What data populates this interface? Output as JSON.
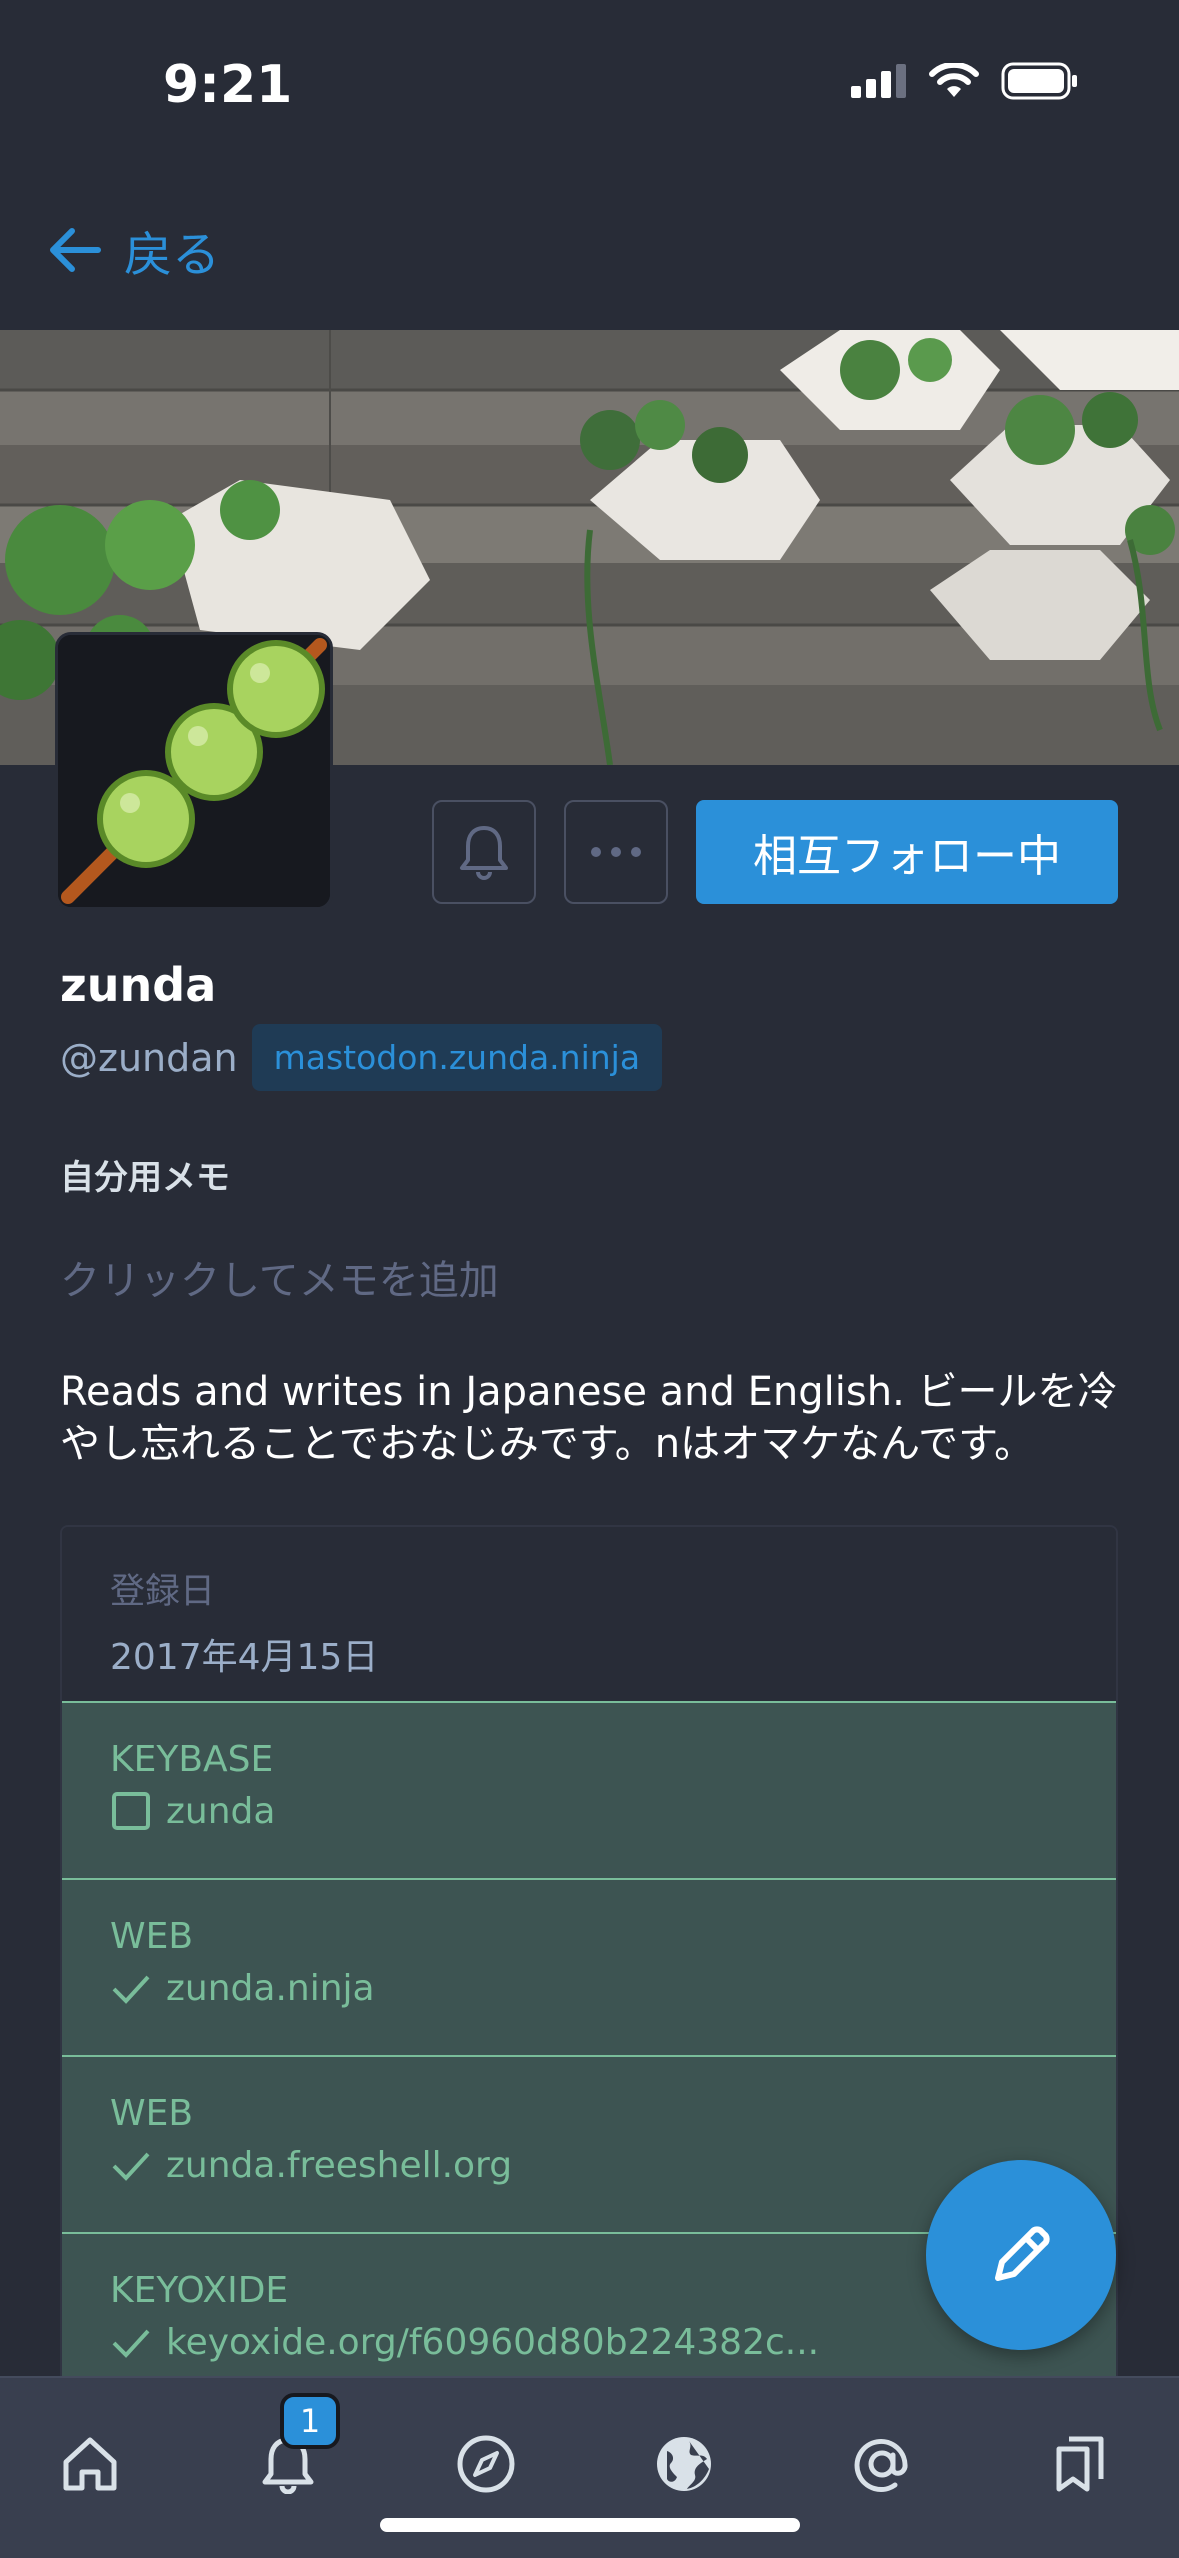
{
  "status_bar": {
    "time": "9:21"
  },
  "nav": {
    "back_label": "戻る"
  },
  "profile": {
    "display_name": "zunda",
    "username": "@zundan",
    "domain": "mastodon.zunda.ninja",
    "follow_label": "相互フォロー中",
    "memo_label": "自分用メモ",
    "memo_placeholder": "クリックしてメモを追加",
    "bio": "Reads and writes in Japanese and English. ビールを冷やし忘れることでおなじみです。nはオマケなんです。"
  },
  "fields": {
    "joined": {
      "label": "登録日",
      "value": "2017年4月15日"
    },
    "items": [
      {
        "label": "KEYBASE",
        "value": "zunda",
        "icon": "checkbox-icon"
      },
      {
        "label": "WEB",
        "value": "zunda.ninja",
        "icon": "check-icon"
      },
      {
        "label": "WEB",
        "value": "zunda.freeshell.org",
        "icon": "check-icon"
      },
      {
        "label": "KEYOXIDE",
        "value": "keyoxide.org/f60960d80b224382c...",
        "icon": "check-icon"
      }
    ]
  },
  "tab_bar": {
    "notification_count": "1",
    "tabs": [
      "home-icon",
      "bell-icon",
      "compass-icon",
      "globe-icon",
      "at-icon",
      "bookmarks-icon"
    ]
  },
  "colors": {
    "background": "#282c37",
    "accent": "#2b90d9",
    "verified": "#79bd9a",
    "verified_bg": "#3d5452",
    "tab_bar": "#393f4f"
  }
}
